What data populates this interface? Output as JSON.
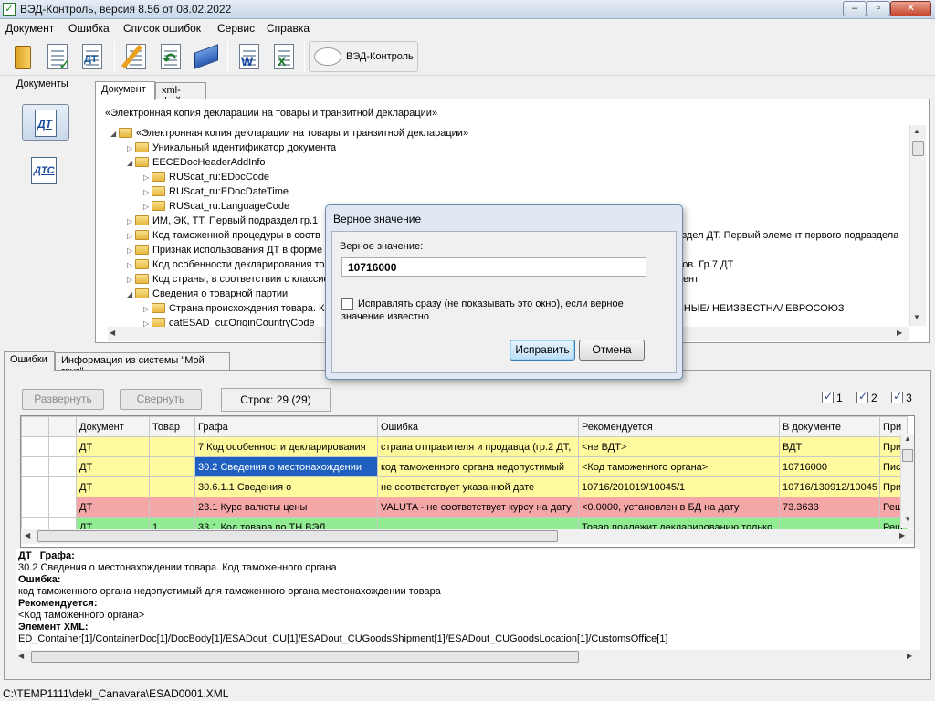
{
  "window": {
    "title": "ВЭД-Контроль, версия 8.56 от 08.02.2022"
  },
  "menu": [
    "Документ",
    "Ошибка",
    "Список ошибок",
    "Сервис",
    "Справка"
  ],
  "toolbar": {
    "ved_label": "ВЭД-Контроль",
    "dt_label": "ДТ"
  },
  "side": {
    "title": "Документы",
    "dt": "ДТ",
    "dtc": "ДТС"
  },
  "doc_tabs": [
    "Документ",
    "xml-файл"
  ],
  "tree": {
    "header": "«Электронная копия декларации на товары и транзитной декларации»",
    "rows": [
      {
        "text": "«Электронная копия декларации на товары и транзитной декларации»",
        "right": ""
      },
      {
        "text": "Уникальный идентификатор документа",
        "right": ""
      },
      {
        "text": "EECEDocHeaderAddInfo",
        "right": ""
      },
      {
        "text": "RUScat_ru:EDocCode",
        "right": ""
      },
      {
        "text": "RUScat_ru:EDocDateTime",
        "right": ""
      },
      {
        "text": "RUScat_ru:LanguageCode",
        "right": ""
      },
      {
        "text": "ИМ, ЭК, ТТ. Первый подраздел гр.1",
        "right": ""
      },
      {
        "text": "Код таможенной процедуры в соотв",
        "right": "раздел ДТ. Первый элемент первого подраздела"
      },
      {
        "text": "Признак использования ДТ в форме з",
        "right": ""
      },
      {
        "text": "Код особенности декларирования то",
        "right": "аров. Гр.7 ДТ"
      },
      {
        "text": "Код страны, в соответствии с классис",
        "right": "умент"
      },
      {
        "text": "Сведения о товарной партии",
        "right": ""
      },
      {
        "text": "Страна происхождения товара. К",
        "right": "АЗНЫЕ/ НЕИЗВЕСТНА/ ЕВРОСОЮЗ"
      },
      {
        "text": "catESAD_cu:OriginCountryCode",
        "right": ""
      }
    ]
  },
  "bottom_tabs": [
    "Ошибки",
    "Информация из системы \"Мой груз\""
  ],
  "errors": {
    "expand_label": "Развернуть",
    "collapse_label": "Свернуть",
    "rows_label": "Строк: 29 (29)",
    "checks": [
      "1",
      "2",
      "3"
    ],
    "columns": [
      "Документ",
      "Товар",
      "Графа",
      "Ошибка",
      "Рекомендуется",
      "В документе",
      "При"
    ],
    "rows": [
      {
        "doc": "ДТ",
        "item": "",
        "field": "7 Код особенности декларирования",
        "error": "страна отправителя и продавца (гр.2 ДТ,",
        "rec": "<не ВДТ>",
        "indoc": "ВДТ",
        "note": "При",
        "color": "y"
      },
      {
        "doc": "ДТ",
        "item": "",
        "field": "30.2 Сведения о местонахождении",
        "error": "код таможенного органа недопустимый",
        "rec": "<Код таможенного органа>",
        "indoc": "10716000",
        "note": "Пись",
        "color": "y"
      },
      {
        "doc": "ДТ",
        "item": "",
        "field": "30.6.1.1 Сведения о",
        "error": "не соответствует указанной дате",
        "rec": "10716/201019/10045/1",
        "indoc": "10716/130912/10045",
        "note": "При",
        "color": "y"
      },
      {
        "doc": "ДТ",
        "item": "",
        "field": "23.1 Курс валюты цены",
        "error": "VALUTA - не соответствует курсу на дату",
        "rec": "<0.0000, установлен в БД на дату",
        "indoc": "73.3633",
        "note": "Реш",
        "color": "r"
      },
      {
        "doc": "ДТ",
        "item": "1",
        "field": "33.1 Код товара по ТН ВЭД",
        "error": "",
        "rec": "Товар подлежит декларированию только",
        "indoc": "",
        "note": "Реш",
        "color": "g"
      }
    ]
  },
  "details": {
    "head_doc": "ДТ",
    "head_field_label": "Графа:",
    "field": "30.2 Сведения о местонахождении товара. Код таможенного органа",
    "error_label": "Ошибка:",
    "error": "код таможенного органа недопустимый для таможенного органа местонахождении товара",
    "error_tail": ":",
    "rec_label": "Рекомендуется:",
    "rec": "<Код таможенного органа>",
    "xml_label": "Элемент XML:",
    "xml": "ED_Container[1]/ContainerDoc[1]/DocBody[1]/ESADout_CU[1]/ESADout_CUGoodsShipment[1]/ESADout_CUGoodsLocation[1]/CustomsOffice[1]"
  },
  "status": {
    "path": "C:\\TEMP1111\\dekl_Canavara\\ESAD0001.XML"
  },
  "dialog": {
    "title": "Верное значение",
    "label": "Верное значение:",
    "value": "10716000",
    "checkbox": "Исправлять сразу (не показывать это окно), если верное значение известно",
    "ok": "Исправить",
    "cancel": "Отмена"
  }
}
